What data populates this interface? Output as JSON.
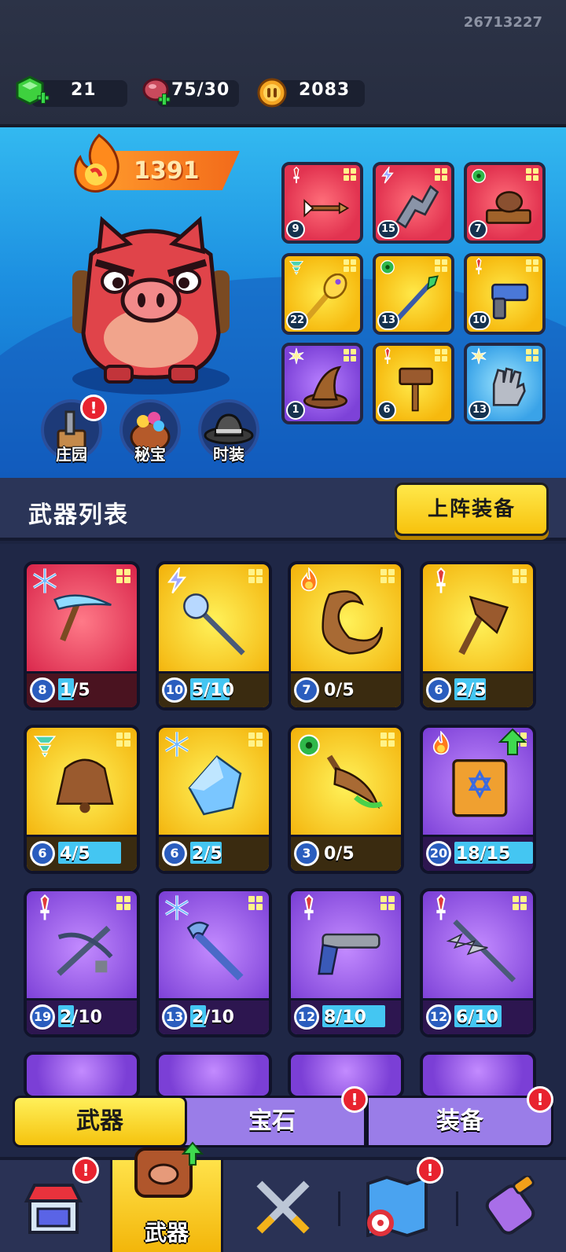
{
  "top": {
    "uid": "26713227",
    "gems": "21",
    "stamina": "75/30",
    "coins": "2083"
  },
  "hero": {
    "power": "1391",
    "slots": [
      {
        "level": "9",
        "rarity": "red",
        "element": "attack",
        "weapon": "arrow"
      },
      {
        "level": "15",
        "rarity": "red",
        "element": "lightning",
        "weapon": "boomerang"
      },
      {
        "level": "7",
        "rarity": "red",
        "element": "poison",
        "weapon": "stone-hammer"
      },
      {
        "level": "22",
        "rarity": "yellow",
        "element": "wind",
        "weapon": "golden-staff"
      },
      {
        "level": "13",
        "rarity": "yellow",
        "element": "poison",
        "weapon": "spear"
      },
      {
        "level": "10",
        "rarity": "yellow",
        "element": "attack",
        "weapon": "blaster"
      },
      {
        "level": "1",
        "rarity": "purple",
        "element": "burst",
        "weapon": "witch-hat"
      },
      {
        "level": "6",
        "rarity": "yellow",
        "element": "attack",
        "weapon": "hammer"
      },
      {
        "level": "13",
        "rarity": "blue",
        "element": "burst",
        "weapon": "gauntlet"
      }
    ],
    "buttons": {
      "manor": "庄园",
      "treasure": "秘宝",
      "fashion": "时装"
    }
  },
  "list": {
    "title": "武器列表",
    "deploy": "上阵装备"
  },
  "weapons": [
    {
      "level": "8",
      "count": "1/5",
      "progress": 0.2,
      "rarity": "red",
      "element": "ice",
      "weapon": "pickaxe"
    },
    {
      "level": "10",
      "count": "5/10",
      "progress": 0.5,
      "rarity": "yellow",
      "element": "lightning",
      "weapon": "magic-staff"
    },
    {
      "level": "7",
      "count": "0/5",
      "progress": 0,
      "rarity": "yellow",
      "element": "fire",
      "weapon": "horn-blade"
    },
    {
      "level": "6",
      "count": "2/5",
      "progress": 0.4,
      "rarity": "yellow",
      "element": "attack",
      "weapon": "axe"
    },
    {
      "level": "6",
      "count": "4/5",
      "progress": 0.8,
      "rarity": "yellow",
      "element": "wind",
      "weapon": "bell"
    },
    {
      "level": "6",
      "count": "2/5",
      "progress": 0.4,
      "rarity": "yellow",
      "element": "ice",
      "weapon": "crystal"
    },
    {
      "level": "3",
      "count": "0/5",
      "progress": 0,
      "rarity": "yellow",
      "element": "poison",
      "weapon": "poison-dagger"
    },
    {
      "level": "20",
      "count": "18/15",
      "progress": 1,
      "rarity": "purple",
      "element": "fire",
      "weapon": "spellbook",
      "upgrade": true
    },
    {
      "level": "19",
      "count": "2/10",
      "progress": 0.2,
      "rarity": "purple",
      "element": "attack",
      "weapon": "crossbow"
    },
    {
      "level": "13",
      "count": "2/10",
      "progress": 0.2,
      "rarity": "purple",
      "element": "ice",
      "weapon": "ice-wrench"
    },
    {
      "level": "12",
      "count": "8/10",
      "progress": 0.8,
      "rarity": "purple",
      "element": "attack",
      "weapon": "pistol"
    },
    {
      "level": "12",
      "count": "6/10",
      "progress": 0.6,
      "rarity": "purple",
      "element": "attack",
      "weapon": "spiked-spear"
    }
  ],
  "subtabs": {
    "weapon": "武器",
    "gem": "宝石",
    "equip": "装备"
  },
  "nav": {
    "weapon": "武器"
  },
  "colors": {
    "yellow": "#f6c20e",
    "purple": "#7b3fd6",
    "red": "#d9264b",
    "alert": "#e8232f"
  }
}
